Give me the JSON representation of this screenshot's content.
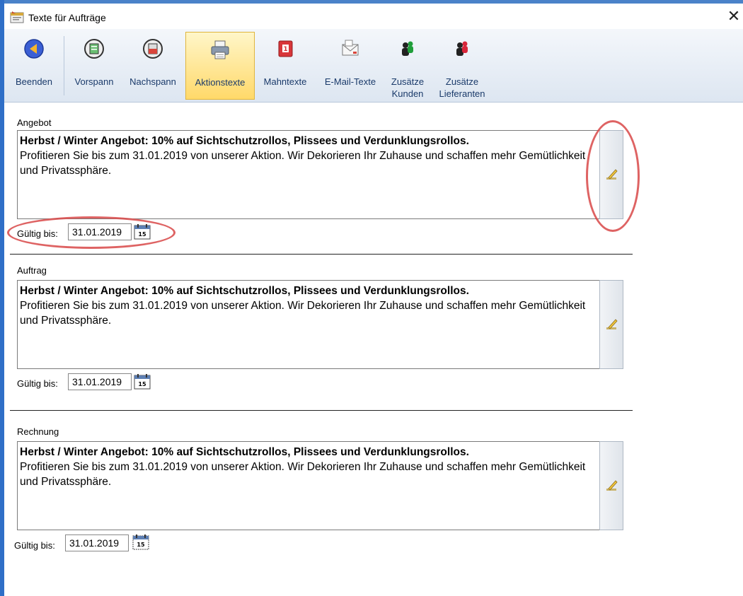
{
  "window": {
    "title": "Texte für Aufträge",
    "close_glyph": "✕"
  },
  "toolbar": {
    "items": [
      {
        "label": "Beenden",
        "icon": "arrow-left-circle-icon"
      },
      {
        "label": "Vorspann",
        "icon": "document-green-icon"
      },
      {
        "label": "Nachspann",
        "icon": "document-red-icon"
      },
      {
        "label": "Aktionstexte",
        "icon": "printer-icon",
        "active": true
      },
      {
        "label": "Mahntexte",
        "icon": "red-book-icon"
      },
      {
        "label": "E-Mail-Texte",
        "icon": "envelope-icon"
      },
      {
        "label": "Zusätze\nKunden",
        "label1": "Zusätze",
        "label2": "Kunden",
        "icon": "people-green-icon"
      },
      {
        "label": "Zusätze\nLieferanten",
        "label1": "Zusätze",
        "label2": "Lieferanten",
        "icon": "people-red-icon"
      }
    ]
  },
  "sections": [
    {
      "label": "Angebot",
      "headline": "Herbst / Winter Angebot: 10% auf Sichtschutzrollos, Plissees und Verdunklungsrollos.",
      "body": "Profitieren Sie bis zum 31.01.2019 von unserer Aktion. Wir Dekorieren Ihr Zuhause und schaffen mehr Gemütlichkeit und Privatssphäre.",
      "valid_label": "Gültig bis:",
      "valid_date": "31.01.2019"
    },
    {
      "label": "Auftrag",
      "headline": "Herbst / Winter Angebot: 10% auf Sichtschutzrollos, Plissees und Verdunklungsrollos.",
      "body": "Profitieren Sie bis zum 31.01.2019 von unserer Aktion. Wir Dekorieren Ihr Zuhause und schaffen mehr Gemütlichkeit und Privatssphäre.",
      "valid_label": "Gültig bis:",
      "valid_date": "31.01.2019"
    },
    {
      "label": "Rechnung",
      "headline": "Herbst / Winter Angebot: 10% auf Sichtschutzrollos, Plissees und Verdunklungsrollos.",
      "body": "Profitieren Sie bis zum 31.01.2019 von unserer Aktion. Wir Dekorieren Ihr Zuhause und schaffen mehr Gemütlichkeit und Privatssphäre.",
      "valid_label": "Gültig bis:",
      "valid_date": "31.01.2019"
    }
  ],
  "calendar_day": "15",
  "colors": {
    "accent": "#2f6fc7",
    "active_button": "#ffd96a",
    "highlight": "#d84848"
  }
}
